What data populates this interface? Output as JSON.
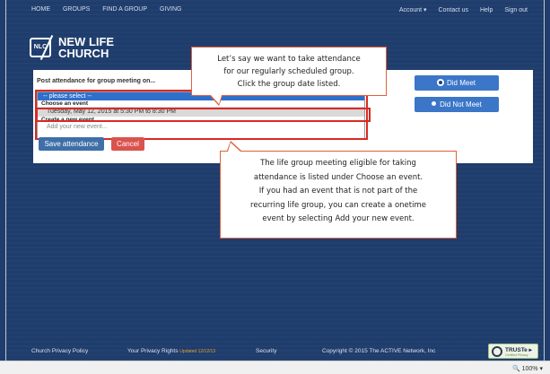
{
  "topnav": {
    "left": [
      "HOME",
      "GROUPS",
      "FIND A GROUP",
      "GIVING"
    ],
    "right": [
      "Account ▾",
      "Contact us",
      "Help",
      "Sign out"
    ]
  },
  "logo": {
    "mark": "NLC",
    "line1": "NEW LIFE",
    "line2": "CHURCH"
  },
  "form": {
    "label": "Post attendance for group meeting on...",
    "select_selected": "-- please select --",
    "group_choose": "Choose an event",
    "event_date": "Tuesday, May 12, 2015 at 5:30 PM to 8:30 PM",
    "group_create": "Create a new event",
    "add_event": "Add your new event...",
    "save_label": "Save attendance",
    "cancel_label": "Cancel",
    "did_meet": "Did Meet",
    "did_not_meet": "Did Not Meet"
  },
  "callouts": {
    "top": [
      "Let’s say we want to take attendance",
      "for our regularly scheduled group.",
      "Click the group date listed."
    ],
    "bottom": [
      "The life group meeting eligible for taking",
      "attendance is listed under Choose an event.",
      "If you had an event that is not part of the",
      "recurring life group, you can create a onetime",
      "event by selecting Add your new event."
    ]
  },
  "footer": {
    "privacy_policy": "Church Privacy Policy",
    "privacy_rights": "Your Privacy Rights",
    "updated": "Updated 12/12/13",
    "security": "Security",
    "copyright": "Copyright © 2015 The ACTIVE Network, Inc",
    "truste": "TRUSTe ▸",
    "truste_sub": "Certified Privacy"
  },
  "status": {
    "zoom": "🔍 100%  ▾"
  },
  "colors": {
    "accent": "#3b76c8",
    "annotation": "#d82a22",
    "background": "#1e3c6c"
  }
}
